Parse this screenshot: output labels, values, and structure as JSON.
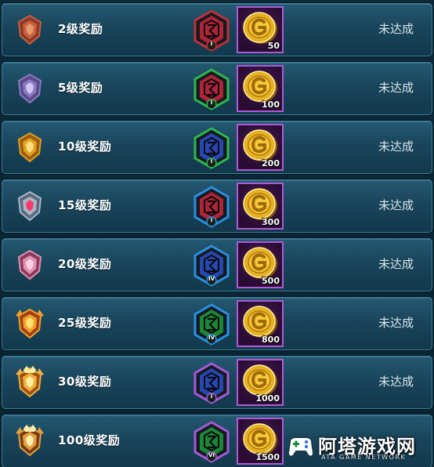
{
  "colors": {
    "row_bg": "#1b4a60",
    "row_border": "#3b7f9c",
    "coin_card_border": "#b05ad8",
    "status_text": "#d8e4ea"
  },
  "rewards": [
    {
      "label": "2级奖励",
      "rank_icon": "rank-badge-bronze-icon",
      "shard_icon": "red-hero-shard-icon",
      "shard_color": "#c8283a",
      "shard_frame": "#c0303a",
      "shard_level": "I",
      "coin_icon": "gold-coin-icon",
      "coin_amount": "50",
      "status": "未达成"
    },
    {
      "label": "5级奖励",
      "rank_icon": "rank-badge-silver-icon",
      "shard_icon": "red-hero-shard-icon",
      "shard_color": "#c8283a",
      "shard_frame": "#2fb84a",
      "shard_level": "I",
      "coin_icon": "gold-coin-icon",
      "coin_amount": "100",
      "status": "未达成"
    },
    {
      "label": "10级奖励",
      "rank_icon": "rank-badge-gold-icon",
      "shard_icon": "blue-hero-shard-icon",
      "shard_color": "#2a52c8",
      "shard_frame": "#2fb84a",
      "shard_level": "I",
      "coin_icon": "gold-coin-icon",
      "coin_amount": "200",
      "status": "未达成"
    },
    {
      "label": "15级奖励",
      "rank_icon": "rank-badge-platinum-icon",
      "shard_icon": "red-hero-shard-icon",
      "shard_color": "#c8283a",
      "shard_frame": "#2a8fe0",
      "shard_level": "I",
      "coin_icon": "gold-coin-icon",
      "coin_amount": "300",
      "status": "未达成"
    },
    {
      "label": "20级奖励",
      "rank_icon": "rank-badge-diamond-icon",
      "shard_icon": "blue-hero-shard-icon",
      "shard_color": "#2a52c8",
      "shard_frame": "#2a8fe0",
      "shard_level": "IV",
      "coin_icon": "gold-coin-icon",
      "coin_amount": "500",
      "status": "未达成"
    },
    {
      "label": "25级奖励",
      "rank_icon": "rank-badge-star-icon",
      "shard_icon": "green-hero-shard-icon",
      "shard_color": "#1f9a3a",
      "shard_frame": "#2a8fe0",
      "shard_level": "IV",
      "coin_icon": "gold-coin-icon",
      "coin_amount": "800",
      "status": "未达成"
    },
    {
      "label": "30级奖励",
      "rank_icon": "rank-badge-master-icon",
      "shard_icon": "blue-hero-shard-icon",
      "shard_color": "#2a52c8",
      "shard_frame": "#a55ad8",
      "shard_level": "I",
      "coin_icon": "gold-coin-icon",
      "coin_amount": "1000",
      "status": "未达成"
    },
    {
      "label": "100级奖励",
      "rank_icon": "rank-badge-king-icon",
      "shard_icon": "green-hero-shard-icon",
      "shard_color": "#1f9a3a",
      "shard_frame": "#a55ad8",
      "shard_level": "VI",
      "coin_icon": "gold-coin-icon",
      "coin_amount": "1500",
      "status": ""
    }
  ],
  "watermark": {
    "title": "阿塔游戏网",
    "subtitle": "ATA GAME NETWORK",
    "icon": "gamepad-logo-icon"
  }
}
